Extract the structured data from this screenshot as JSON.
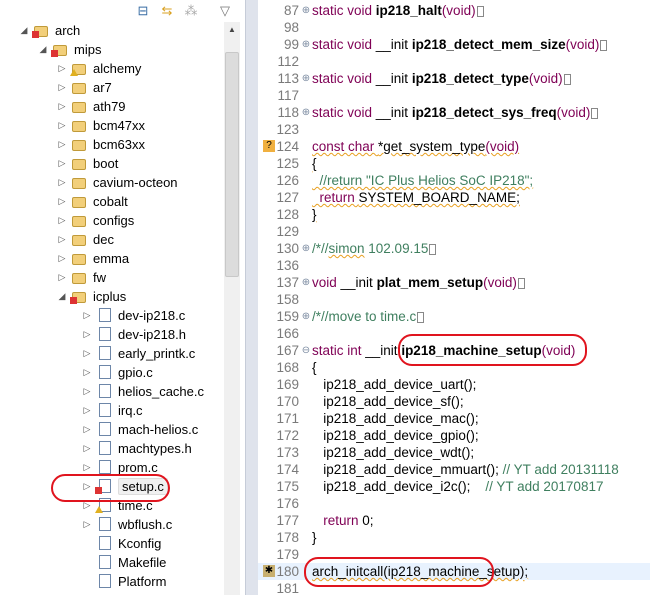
{
  "toolbar": {
    "icons": [
      "collapse-all-icon",
      "link-with-editor-icon",
      "filter-icon",
      "view-menu-icon"
    ]
  },
  "tree": [
    {
      "label": "arch",
      "level": 0,
      "expand": "open",
      "icon": "folder",
      "overlay": "error"
    },
    {
      "label": "mips",
      "level": 1,
      "expand": "open",
      "icon": "folder",
      "overlay": "error"
    },
    {
      "label": "alchemy",
      "level": 2,
      "expand": "closed",
      "icon": "folder",
      "overlay": "warning"
    },
    {
      "label": "ar7",
      "level": 2,
      "expand": "closed",
      "icon": "folder"
    },
    {
      "label": "ath79",
      "level": 2,
      "expand": "closed",
      "icon": "folder"
    },
    {
      "label": "bcm47xx",
      "level": 2,
      "expand": "closed",
      "icon": "folder"
    },
    {
      "label": "bcm63xx",
      "level": 2,
      "expand": "closed",
      "icon": "folder"
    },
    {
      "label": "boot",
      "level": 2,
      "expand": "closed",
      "icon": "folder"
    },
    {
      "label": "cavium-octeon",
      "level": 2,
      "expand": "closed",
      "icon": "folder"
    },
    {
      "label": "cobalt",
      "level": 2,
      "expand": "closed",
      "icon": "folder"
    },
    {
      "label": "configs",
      "level": 2,
      "expand": "closed",
      "icon": "folder"
    },
    {
      "label": "dec",
      "level": 2,
      "expand": "closed",
      "icon": "folder"
    },
    {
      "label": "emma",
      "level": 2,
      "expand": "closed",
      "icon": "folder"
    },
    {
      "label": "fw",
      "level": 2,
      "expand": "closed",
      "icon": "folder"
    },
    {
      "label": "icplus",
      "level": 2,
      "expand": "open",
      "icon": "folder",
      "overlay": "error"
    },
    {
      "label": "dev-ip218.c",
      "level": 3,
      "expand": "closed",
      "icon": "file"
    },
    {
      "label": "dev-ip218.h",
      "level": 3,
      "expand": "closed",
      "icon": "file"
    },
    {
      "label": "early_printk.c",
      "level": 3,
      "expand": "closed",
      "icon": "file"
    },
    {
      "label": "gpio.c",
      "level": 3,
      "expand": "closed",
      "icon": "file"
    },
    {
      "label": "helios_cache.c",
      "level": 3,
      "expand": "closed",
      "icon": "file"
    },
    {
      "label": "irq.c",
      "level": 3,
      "expand": "closed",
      "icon": "file"
    },
    {
      "label": "mach-helios.c",
      "level": 3,
      "expand": "closed",
      "icon": "file"
    },
    {
      "label": "machtypes.h",
      "level": 3,
      "expand": "closed",
      "icon": "file"
    },
    {
      "label": "prom.c",
      "level": 3,
      "expand": "closed",
      "icon": "file"
    },
    {
      "label": "setup.c",
      "level": 3,
      "expand": "closed",
      "icon": "file",
      "overlay": "error",
      "selected": true
    },
    {
      "label": "time.c",
      "level": 3,
      "expand": "closed",
      "icon": "file",
      "overlay": "warning"
    },
    {
      "label": "wbflush.c",
      "level": 3,
      "expand": "closed",
      "icon": "file"
    },
    {
      "label": "Kconfig",
      "level": 3,
      "expand": "none",
      "icon": "file"
    },
    {
      "label": "Makefile",
      "level": 3,
      "expand": "none",
      "icon": "file"
    },
    {
      "label": "Platform",
      "level": 3,
      "expand": "none",
      "icon": "file"
    }
  ],
  "code": [
    {
      "n": "87",
      "fold": "+",
      "segs": [
        [
          "kw",
          "static void "
        ],
        [
          "fn",
          "ip218_halt"
        ],
        [
          "kw",
          "(void)"
        ],
        [
          "box",
          ""
        ]
      ]
    },
    {
      "n": "98",
      "segs": []
    },
    {
      "n": "99",
      "fold": "+",
      "segs": [
        [
          "kw",
          "static void "
        ],
        [
          "tx",
          "__init "
        ],
        [
          "fn",
          "ip218_detect_mem_size"
        ],
        [
          "kw",
          "(void)"
        ],
        [
          "box",
          ""
        ]
      ]
    },
    {
      "n": "112",
      "segs": []
    },
    {
      "n": "113",
      "fold": "+",
      "segs": [
        [
          "kw",
          "static void "
        ],
        [
          "tx",
          "__init "
        ],
        [
          "fn",
          "ip218_detect_type"
        ],
        [
          "kw",
          "(void)"
        ],
        [
          "box",
          ""
        ]
      ]
    },
    {
      "n": "117",
      "segs": []
    },
    {
      "n": "118",
      "fold": "+",
      "segs": [
        [
          "kw",
          "static void "
        ],
        [
          "tx",
          "__init "
        ],
        [
          "fn",
          "ip218_detect_sys_freq"
        ],
        [
          "kw",
          "(void)"
        ],
        [
          "box",
          ""
        ]
      ]
    },
    {
      "n": "123",
      "segs": []
    },
    {
      "n": "124",
      "marker": "?",
      "segs": [
        [
          "kw sq",
          "const char "
        ],
        [
          "tx sq",
          "*get_system_type"
        ],
        [
          "kw sq",
          "(void)"
        ]
      ]
    },
    {
      "n": "125",
      "segs": [
        [
          "tx sq",
          "{"
        ]
      ]
    },
    {
      "n": "126",
      "segs": [
        [
          "cm sq",
          "  //return \"IC Plus Helios SoC IP218\";"
        ]
      ]
    },
    {
      "n": "127",
      "segs": [
        [
          "kw sq",
          "  return "
        ],
        [
          "tx sq",
          "SYSTEM_BOARD_NAME;"
        ]
      ]
    },
    {
      "n": "128",
      "segs": [
        [
          "tx sq",
          "}"
        ]
      ]
    },
    {
      "n": "129",
      "segs": []
    },
    {
      "n": "130",
      "fold": "+",
      "segs": [
        [
          "cm",
          "/*//"
        ],
        [
          "cm sq",
          "simon"
        ],
        [
          "cm",
          " 102.09.15"
        ],
        [
          "box",
          ""
        ]
      ]
    },
    {
      "n": "136",
      "segs": []
    },
    {
      "n": "137",
      "fold": "+",
      "segs": [
        [
          "kw",
          "void "
        ],
        [
          "tx",
          "__init "
        ],
        [
          "fn",
          "plat_mem_setup"
        ],
        [
          "kw",
          "(void)"
        ],
        [
          "box",
          ""
        ]
      ]
    },
    {
      "n": "158",
      "segs": []
    },
    {
      "n": "159",
      "fold": "+",
      "segs": [
        [
          "cm",
          "/*//move to time.c"
        ],
        [
          "box",
          ""
        ]
      ]
    },
    {
      "n": "166",
      "segs": []
    },
    {
      "n": "167",
      "fold": "-",
      "segs": [
        [
          "kw",
          "static int "
        ],
        [
          "tx",
          "__init "
        ],
        [
          "fn",
          "ip218_machine_setup"
        ],
        [
          "kw",
          "(void)"
        ]
      ]
    },
    {
      "n": "168",
      "segs": [
        [
          "tx",
          "{"
        ]
      ]
    },
    {
      "n": "169",
      "segs": [
        [
          "tx",
          "   ip218_add_device_uart();"
        ]
      ]
    },
    {
      "n": "170",
      "segs": [
        [
          "tx",
          "   ip218_add_device_sf();"
        ]
      ]
    },
    {
      "n": "171",
      "segs": [
        [
          "tx",
          "   ip218_add_device_mac();"
        ]
      ]
    },
    {
      "n": "172",
      "segs": [
        [
          "tx",
          "   ip218_add_device_gpio();"
        ]
      ]
    },
    {
      "n": "173",
      "segs": [
        [
          "tx",
          "   ip218_add_device_wdt();"
        ]
      ]
    },
    {
      "n": "174",
      "segs": [
        [
          "tx",
          "   ip218_add_device_mmuart(); "
        ],
        [
          "cm",
          "// YT add 20131118"
        ]
      ]
    },
    {
      "n": "175",
      "segs": [
        [
          "tx",
          "   ip218_add_device_i2c();    "
        ],
        [
          "cm",
          "// YT add 20170817"
        ]
      ]
    },
    {
      "n": "176",
      "segs": []
    },
    {
      "n": "177",
      "segs": [
        [
          "kw",
          "   return "
        ],
        [
          "tx",
          "0;"
        ]
      ]
    },
    {
      "n": "178",
      "segs": [
        [
          "tx",
          "}"
        ]
      ]
    },
    {
      "n": "179",
      "segs": []
    },
    {
      "n": "180",
      "marker": "bug",
      "current": true,
      "segs": [
        [
          "tx sq",
          "arch_initcall(ip218_machine_setup);"
        ]
      ]
    },
    {
      "n": "181",
      "segs": []
    }
  ],
  "colors": {
    "keyword": "#7f0055",
    "comment": "#3f7f5f",
    "annotation": "#e0141e"
  }
}
